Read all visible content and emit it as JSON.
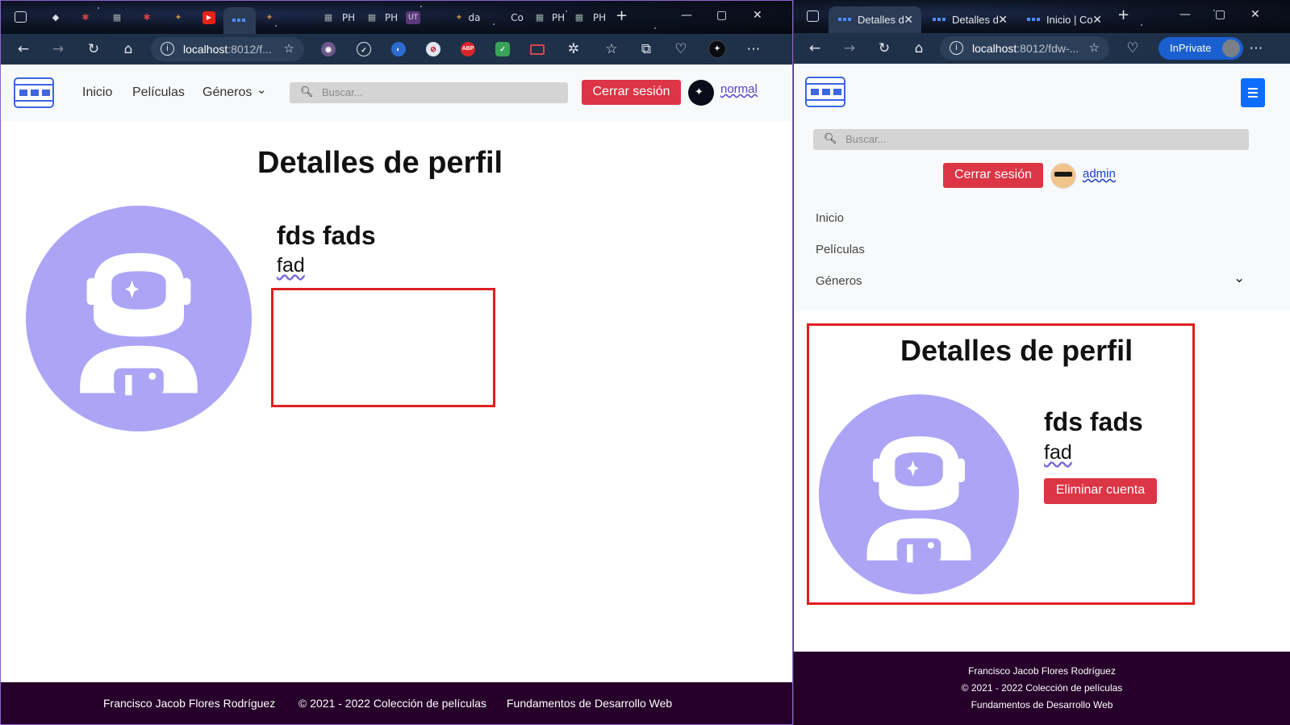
{
  "left_window": {
    "tabs": [
      {
        "label": "PH"
      },
      {
        "label": "PH"
      },
      {
        "label": "UT"
      },
      {
        "label": "da"
      },
      {
        "label": "Co"
      },
      {
        "label": "PH"
      },
      {
        "label": "PH"
      }
    ],
    "address": {
      "host": "localhost",
      "path": ":8012/f..."
    },
    "site": {
      "nav": [
        "Inicio",
        "Películas",
        "Géneros"
      ],
      "search_placeholder": "Buscar...",
      "logout_label": "Cerrar sesión",
      "username": "normal"
    },
    "profile": {
      "title": "Detalles de perfil",
      "full_name": "fds fads",
      "username": "fad"
    },
    "footer": [
      "Francisco Jacob Flores Rodríguez",
      "© 2021 - 2022 Colección de películas",
      "Fundamentos de Desarrollo Web"
    ]
  },
  "right_window": {
    "tabs": [
      {
        "label": "Detalles d"
      },
      {
        "label": "Detalles d"
      },
      {
        "label": "Inicio | Co"
      }
    ],
    "address": {
      "host": "localhost",
      "path": ":8012/fdw-..."
    },
    "inprivate_label": "InPrivate",
    "site": {
      "nav": [
        "Inicio",
        "Películas",
        "Géneros"
      ],
      "search_placeholder": "Buscar...",
      "logout_label": "Cerrar sesión",
      "username": "admin"
    },
    "profile": {
      "title": "Detalles de perfil",
      "full_name": "fds fads",
      "username": "fad",
      "delete_label": "Eliminar cuenta"
    },
    "footer": [
      "Francisco Jacob Flores Rodríguez",
      "© 2021 - 2022 Colección de películas",
      "Fundamentos de Desarrollo Web"
    ]
  },
  "colors": {
    "accent_red": "#dc3545",
    "avatar_purple": "#ada4f6",
    "footer_bg": "#26002a",
    "highlight_box": "#e02020",
    "browser_toolbar": "#1f3148"
  }
}
